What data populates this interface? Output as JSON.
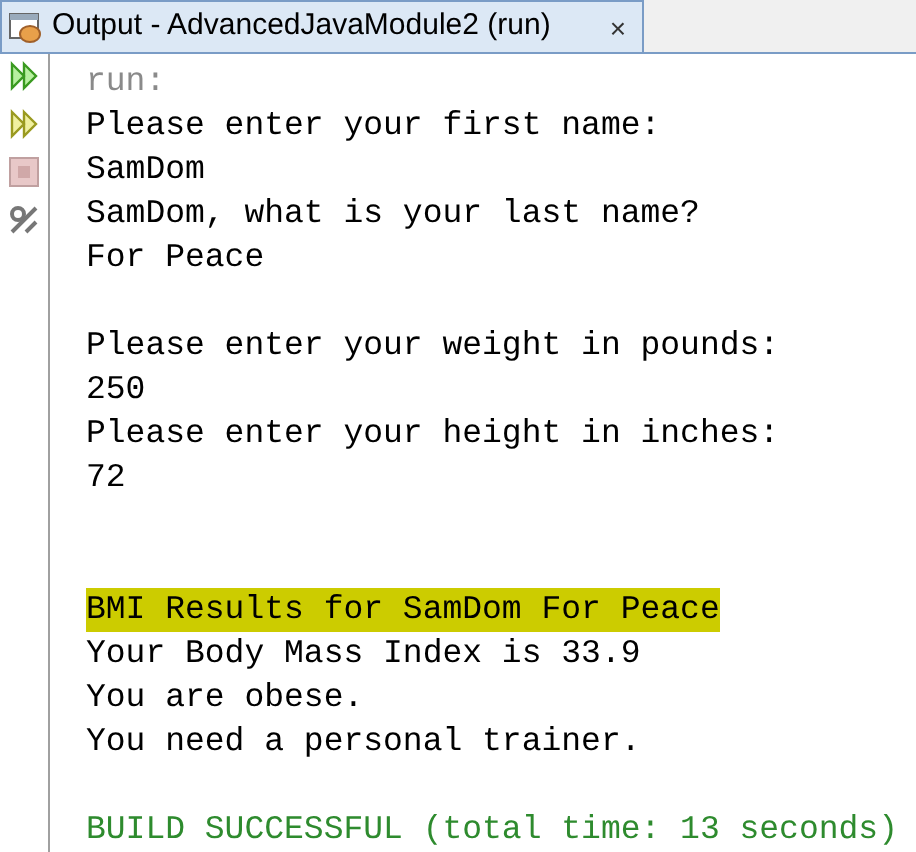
{
  "tab": {
    "title": "Output - AdvancedJavaModule2 (run)",
    "close": "×"
  },
  "lines": [
    {
      "kind": "muted",
      "text": "run:"
    },
    {
      "kind": "normal",
      "text": "Please enter your first name:"
    },
    {
      "kind": "normal",
      "text": "SamDom"
    },
    {
      "kind": "normal",
      "text": "SamDom, what is your last name?"
    },
    {
      "kind": "normal",
      "text": "For Peace"
    },
    {
      "kind": "blank"
    },
    {
      "kind": "normal",
      "text": "Please enter your weight in pounds:"
    },
    {
      "kind": "normal",
      "text": "250"
    },
    {
      "kind": "normal",
      "text": "Please enter your height in inches:"
    },
    {
      "kind": "normal",
      "text": "72"
    },
    {
      "kind": "blank"
    },
    {
      "kind": "blank"
    },
    {
      "kind": "highlight",
      "text": "BMI Results for SamDom For Peace"
    },
    {
      "kind": "normal",
      "text": "Your Body Mass Index is 33.9"
    },
    {
      "kind": "normal",
      "text": "You are obese."
    },
    {
      "kind": "normal",
      "text": "You need a personal trainer."
    },
    {
      "kind": "blank"
    },
    {
      "kind": "success",
      "text": "BUILD SUCCESSFUL (total time: 13 seconds)"
    }
  ]
}
